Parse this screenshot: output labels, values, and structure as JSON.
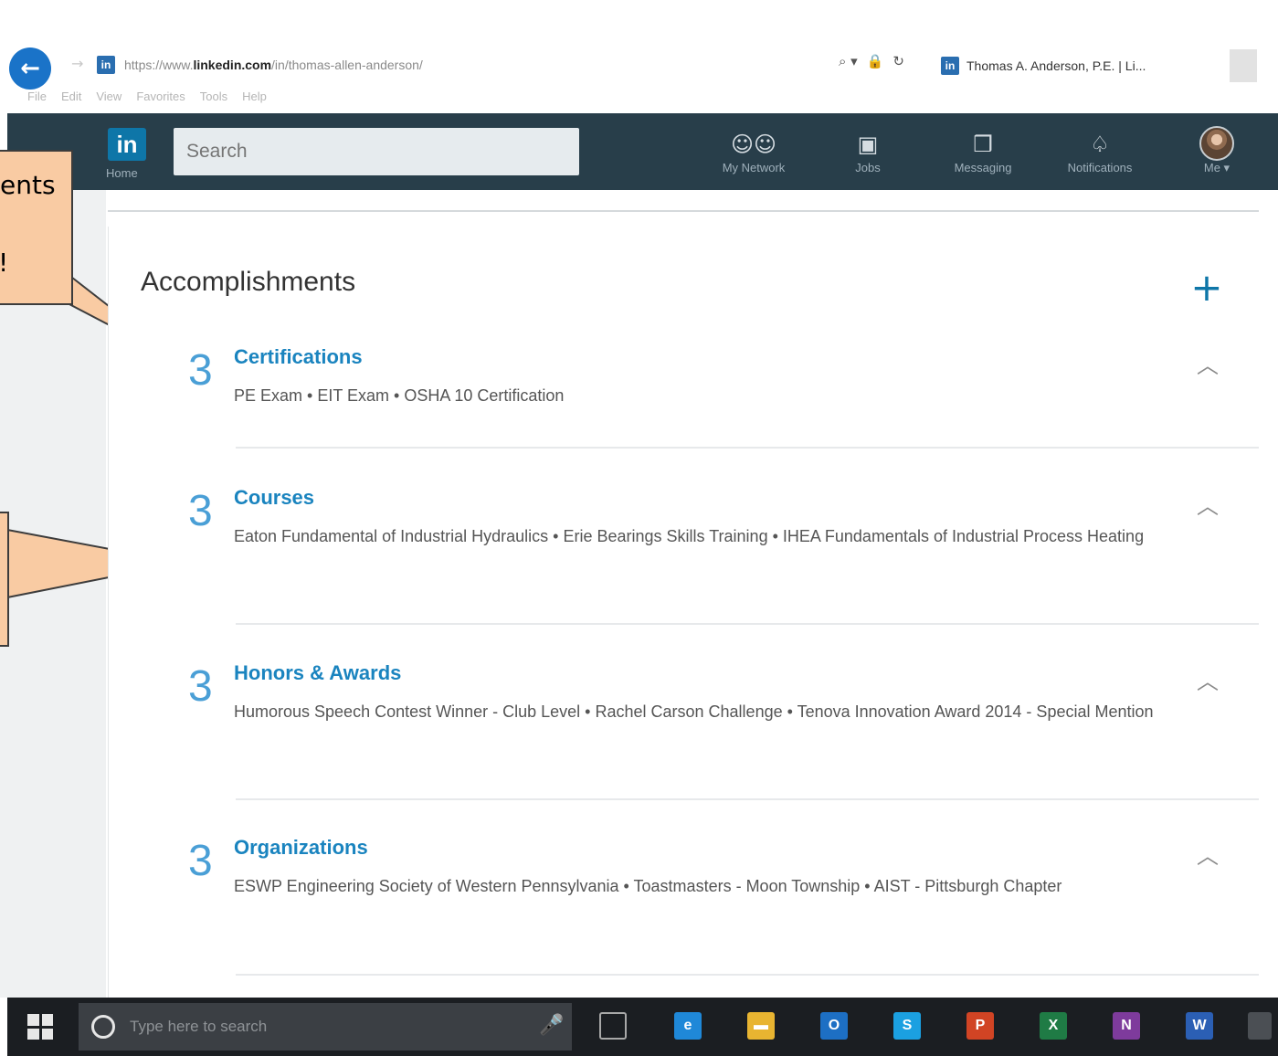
{
  "browser": {
    "url_prefix": "https://www.",
    "url_host": "linkedin.com",
    "url_path": "/in/thomas-allen-anderson/",
    "tools": [
      "⌕ ▾",
      "🔒",
      "↻"
    ],
    "tab_title": "Thomas A. Anderson, P.E. | Li...",
    "menu": [
      "File",
      "Edit",
      "View",
      "Favorites",
      "Tools",
      "Help"
    ]
  },
  "nav": {
    "logo": "in",
    "home_label": "Home",
    "search_placeholder": "Search",
    "items": [
      {
        "label": "My Network"
      },
      {
        "label": "Jobs"
      },
      {
        "label": "Messaging"
      },
      {
        "label": "Notifications"
      },
      {
        "label": "Me ▾"
      }
    ]
  },
  "callouts": {
    "first_line1": "ents",
    "first_line2": "!"
  },
  "accomplishments": {
    "title": "Accomplishments",
    "add_label": "+",
    "items": [
      {
        "count": "3",
        "title": "Certifications",
        "desc": "PE Exam  •  EIT Exam  •  OSHA 10 Certification"
      },
      {
        "count": "3",
        "title": "Courses",
        "desc": "Eaton Fundamental of Industrial Hydraulics  •  Erie Bearings Skills Training  •  IHEA Fundamentals of Industrial Process Heating"
      },
      {
        "count": "3",
        "title": "Honors & Awards",
        "desc": "Humorous Speech Contest Winner - Club Level  •  Rachel Carson Challenge  •  Tenova Innovation Award 2014 - Special Mention"
      },
      {
        "count": "3",
        "title": "Organizations",
        "desc": "ESWP Engineering Society of Western Pennsylvania  •  Toastmasters - Moon Township  •  AIST - Pittsburgh Chapter"
      }
    ]
  },
  "taskbar": {
    "search_placeholder": "Type here to search",
    "apps": [
      {
        "label": "e",
        "color": "#1f88d8"
      },
      {
        "label": "▬",
        "color": "#e8b431"
      },
      {
        "label": "O",
        "color": "#1d6fc4"
      },
      {
        "label": "S",
        "color": "#1ba0e1"
      },
      {
        "label": "P",
        "color": "#d14424"
      },
      {
        "label": "X",
        "color": "#1f7b45"
      },
      {
        "label": "N",
        "color": "#7e3b9c"
      },
      {
        "label": "W",
        "color": "#2b5fb4"
      }
    ]
  }
}
